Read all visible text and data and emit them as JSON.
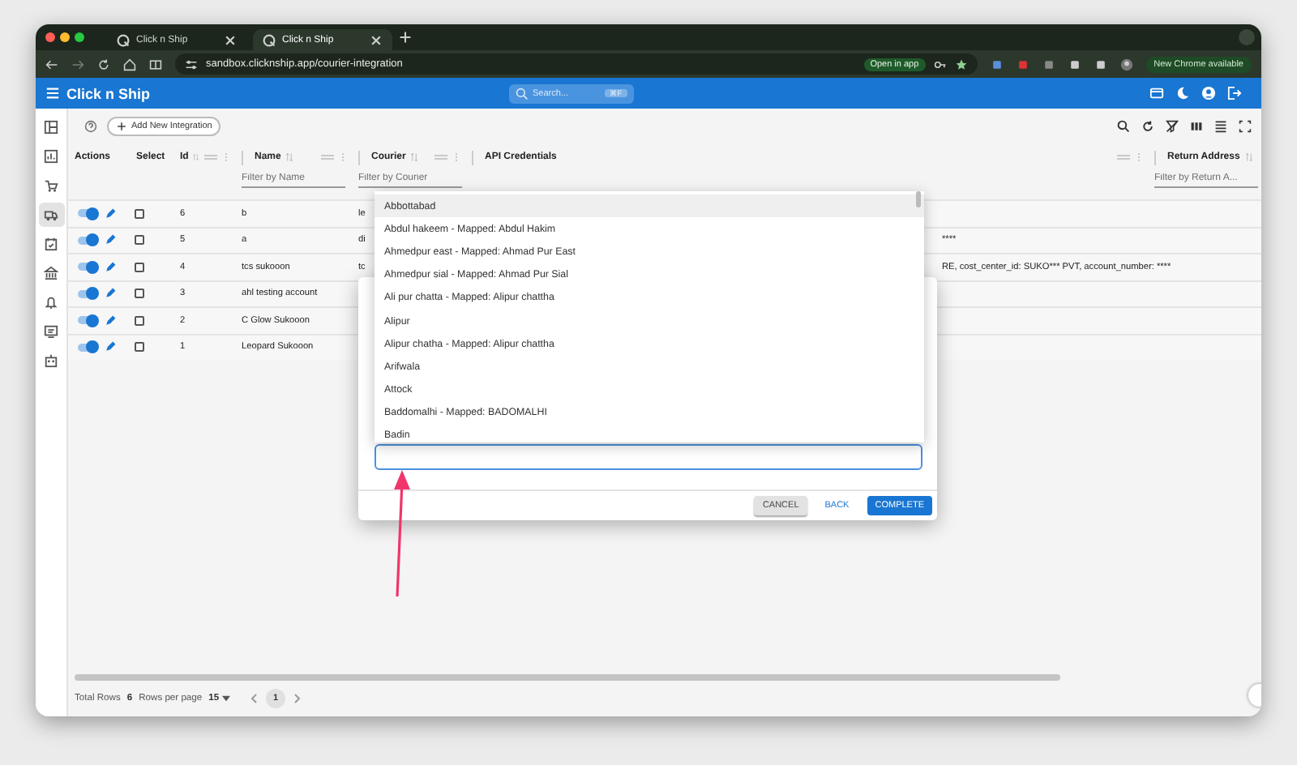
{
  "browser": {
    "tabs": [
      {
        "label": "Click n Ship",
        "selected": false
      },
      {
        "label": "Click n Ship",
        "selected": true
      }
    ],
    "url": "sandbox.clicknship.app/courier-integration",
    "open_in_app": "Open in app",
    "update_button": "New Chrome available"
  },
  "app": {
    "title": "Click n Ship",
    "search": {
      "placeholder": "Search...",
      "shortcut": "⌘F"
    }
  },
  "sidebar": {
    "items": [
      {
        "kind": "layout",
        "selected": false
      },
      {
        "kind": "chart",
        "selected": false
      },
      {
        "kind": "cart",
        "selected": false
      },
      {
        "kind": "truck",
        "selected": true
      },
      {
        "kind": "calendar",
        "selected": false
      },
      {
        "kind": "bank",
        "selected": false
      },
      {
        "kind": "bell",
        "selected": false
      },
      {
        "kind": "monitor",
        "selected": false
      },
      {
        "kind": "robot",
        "selected": false
      }
    ]
  },
  "toolbar": {
    "add_button": "Add New Integration"
  },
  "table": {
    "columns": [
      {
        "label": "Actions",
        "sortable": false,
        "menu": false
      },
      {
        "label": "Select",
        "sortable": false,
        "menu": false
      },
      {
        "label": "Id",
        "sortable": true,
        "menu": true
      },
      {
        "label": "Name",
        "sortable": true,
        "menu": true,
        "filter_placeholder": "Filter by Name"
      },
      {
        "label": "Courier",
        "sortable": true,
        "menu": true,
        "filter_placeholder": "Filter by Courier"
      },
      {
        "label": "API Credentials",
        "sortable": false,
        "menu": true
      },
      {
        "label": "Return Address",
        "sortable": true,
        "menu": false,
        "filter_placeholder": "Filter by Return A..."
      }
    ],
    "rows": [
      {
        "active": true,
        "selected": false,
        "id": "6",
        "name": "b",
        "courier": "le"
      },
      {
        "active": true,
        "selected": false,
        "id": "5",
        "name": "a",
        "courier": "di",
        "credentials": "****"
      },
      {
        "active": true,
        "selected": false,
        "id": "4",
        "name": "tcs sukooon",
        "courier": "tc",
        "credentials": "RE, cost_center_id: SUKO*** PVT, account_number: ****"
      },
      {
        "active": true,
        "selected": false,
        "id": "3",
        "name": "ahl testing account"
      },
      {
        "active": true,
        "selected": false,
        "id": "2",
        "name": "C Glow Sukooon"
      },
      {
        "active": true,
        "selected": false,
        "id": "1",
        "name": "Leopard Sukooon"
      }
    ]
  },
  "footer": {
    "total_label": "Total Rows",
    "total": "6",
    "per_page_label": "Rows per page",
    "per_page": "15",
    "page": "1"
  },
  "dialog": {
    "options": [
      {
        "label": "Abbottabad",
        "selected": true
      },
      {
        "label": "Abdul hakeem - Mapped: Abdul Hakim",
        "selected": false
      },
      {
        "label": "Ahmedpur east - Mapped: Ahmad Pur East",
        "selected": false
      },
      {
        "label": "Ahmedpur sial - Mapped: Ahmad Pur Sial",
        "selected": false
      },
      {
        "label": "Ali pur chatta - Mapped: Alipur chattha",
        "selected": false
      },
      {
        "label": "Alipur",
        "selected": false
      },
      {
        "label": "Alipur chatha - Mapped: Alipur chattha",
        "selected": false
      },
      {
        "label": "Arifwala",
        "selected": false
      },
      {
        "label": "Attock",
        "selected": false
      },
      {
        "label": "Baddomalhi - Mapped: BADOMALHI",
        "selected": false
      },
      {
        "label": "Badin",
        "selected": false
      }
    ],
    "buttons": [
      {
        "label": "CANCEL",
        "kind": "secondary"
      },
      {
        "label": "BACK",
        "kind": "text"
      },
      {
        "label": "COMPLETE",
        "kind": "primary"
      }
    ]
  }
}
